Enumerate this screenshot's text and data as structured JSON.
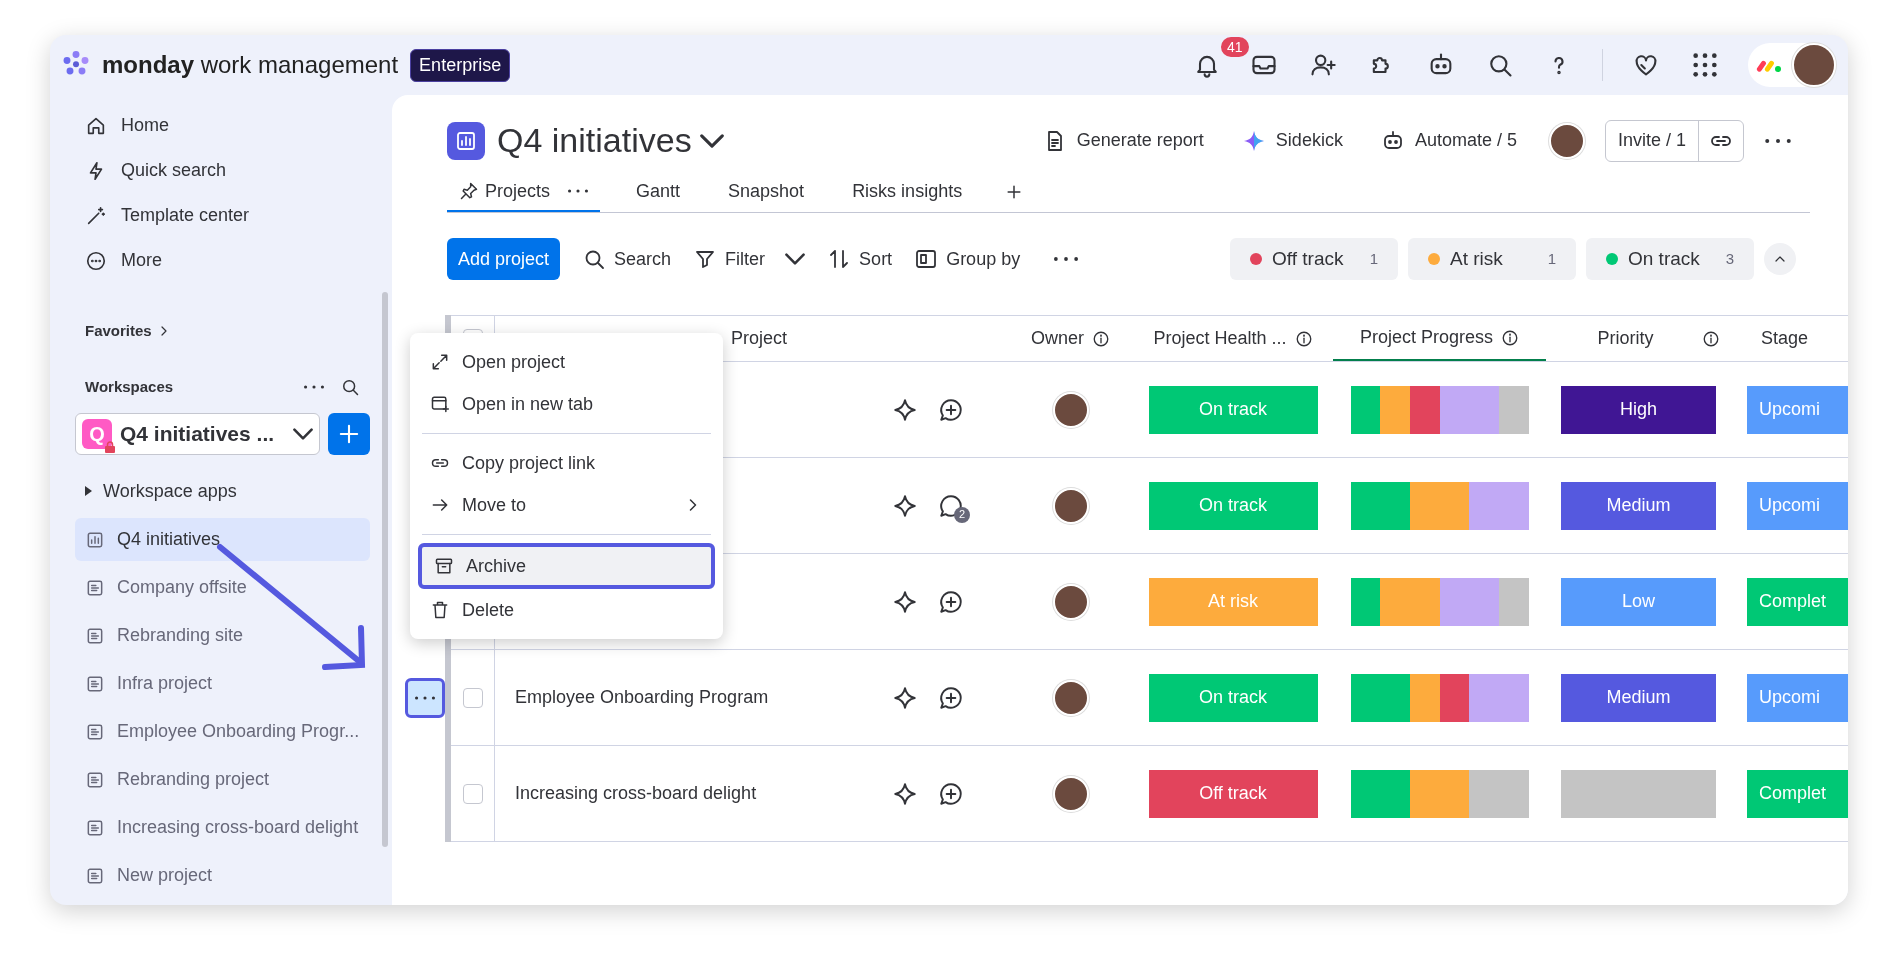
{
  "topbar": {
    "brand_bold": "monday",
    "brand_rest": "work management",
    "plan": "Enterprise",
    "notifications": "41"
  },
  "sidebar": {
    "nav": [
      {
        "label": "Home"
      },
      {
        "label": "Quick search"
      },
      {
        "label": "Template center"
      },
      {
        "label": "More"
      }
    ],
    "favorites": "Favorites",
    "workspaces": "Workspaces",
    "workspace": {
      "name": "Q4 initiatives ...",
      "letter": "Q"
    },
    "apps": {
      "label": "Workspace apps",
      "expanded": false
    },
    "boards": [
      {
        "label": "Q4 initiatives",
        "kind": "dashboard",
        "selected": true
      },
      {
        "label": "Company offsite",
        "kind": "board",
        "selected": false
      },
      {
        "label": "Rebranding site",
        "kind": "board",
        "selected": false
      },
      {
        "label": "Infra project",
        "kind": "board",
        "selected": false
      },
      {
        "label": "Employee Onboarding Progr...",
        "kind": "board",
        "selected": false
      },
      {
        "label": "Rebranding project",
        "kind": "board",
        "selected": false
      },
      {
        "label": "Increasing cross-board delight",
        "kind": "board",
        "selected": false
      },
      {
        "label": "New project",
        "kind": "board",
        "selected": false
      }
    ]
  },
  "header": {
    "title": "Q4 initiatives",
    "actions": [
      "Generate report",
      "Sidekick",
      "Automate / 5"
    ],
    "invite": "Invite / 1"
  },
  "tabs": [
    {
      "label": "Projects",
      "selected": true
    },
    {
      "label": "Gantt",
      "selected": false
    },
    {
      "label": "Snapshot",
      "selected": false
    },
    {
      "label": "Risks insights",
      "selected": false
    }
  ],
  "toolbar": {
    "primary": "Add project",
    "tools": [
      "Search",
      "Filter",
      "Sort",
      "Group by"
    ],
    "status_filters": [
      {
        "label": "Off track",
        "count": "1",
        "color": "#e2445c"
      },
      {
        "label": "At risk",
        "count": "1",
        "color": "#fdab3d"
      },
      {
        "label": "On track",
        "count": "3",
        "color": "#00c875"
      }
    ]
  },
  "table": {
    "select_all_checked": false,
    "columns": [
      "Project",
      "Owner",
      "Project Health ...",
      "Project Progress",
      "Priority",
      "Stage"
    ],
    "rows": [
      {
        "menu_open": false,
        "comments": "",
        "health": {
          "label": "On track",
          "color": "#00c875"
        },
        "progress": [
          {
            "color": "#00c875"
          },
          {
            "color": "#fdab3d"
          },
          {
            "color": "#e2445c"
          },
          {
            "color": "#c1a9f5"
          },
          {
            "color": "#c1a9f5"
          },
          {
            "color": "#c4c4c4"
          }
        ],
        "priority": {
          "label": "High",
          "color": "#401694"
        },
        "stage": {
          "label": "Upcomi",
          "color": "#579bfc"
        }
      },
      {
        "menu_open": false,
        "comments": "2",
        "health": {
          "label": "On track",
          "color": "#00c875"
        },
        "progress": [
          {
            "color": "#00c875"
          },
          {
            "color": "#00c875"
          },
          {
            "color": "#fdab3d"
          },
          {
            "color": "#fdab3d"
          },
          {
            "color": "#c1a9f5"
          },
          {
            "color": "#c1a9f5"
          }
        ],
        "priority": {
          "label": "Medium",
          "color": "#5559df"
        },
        "stage": {
          "label": "Upcomi",
          "color": "#579bfc"
        }
      },
      {
        "menu_open": false,
        "comments": "",
        "health": {
          "label": "At risk",
          "color": "#fdab3d"
        },
        "progress": [
          {
            "color": "#00c875"
          },
          {
            "color": "#fdab3d"
          },
          {
            "color": "#fdab3d"
          },
          {
            "color": "#c1a9f5"
          },
          {
            "color": "#c1a9f5"
          },
          {
            "color": "#c4c4c4"
          }
        ],
        "priority": {
          "label": "Low",
          "color": "#579bfc"
        },
        "stage": {
          "label": "Complet",
          "color": "#00c875"
        }
      },
      {
        "menu_open": true,
        "checked": false,
        "name": "Employee Onboarding Program",
        "comments": "",
        "health": {
          "label": "On track",
          "color": "#00c875"
        },
        "progress": [
          {
            "color": "#00c875"
          },
          {
            "color": "#00c875"
          },
          {
            "color": "#fdab3d"
          },
          {
            "color": "#e2445c"
          },
          {
            "color": "#c1a9f5"
          },
          {
            "color": "#c1a9f5"
          }
        ],
        "priority": {
          "label": "Medium",
          "color": "#5559df"
        },
        "stage": {
          "label": "Upcomi",
          "color": "#579bfc"
        }
      },
      {
        "menu_open": false,
        "checked": false,
        "name": "Increasing cross-board delight",
        "comments": "",
        "health": {
          "label": "Off track",
          "color": "#e2445c"
        },
        "progress": [
          {
            "color": "#00c875"
          },
          {
            "color": "#00c875"
          },
          {
            "color": "#fdab3d"
          },
          {
            "color": "#fdab3d"
          },
          {
            "color": "#c4c4c4"
          },
          {
            "color": "#c4c4c4"
          }
        ],
        "priority": {
          "color": "#c4c4c4"
        },
        "stage": {
          "label": "Complet",
          "color": "#00c875"
        }
      }
    ]
  },
  "context_menu": {
    "sections": [
      {
        "items": [
          {
            "label": "Open project",
            "submenu": false,
            "selected": false
          },
          {
            "label": "Open in new tab",
            "submenu": false,
            "selected": false
          }
        ]
      },
      {
        "items": [
          {
            "label": "Copy project link",
            "submenu": false,
            "selected": false
          },
          {
            "label": "Move to",
            "submenu": true,
            "selected": false
          }
        ]
      },
      {
        "items": [
          {
            "label": "Archive",
            "submenu": false,
            "selected": true
          },
          {
            "label": "Delete",
            "submenu": false,
            "selected": false
          }
        ]
      }
    ]
  }
}
